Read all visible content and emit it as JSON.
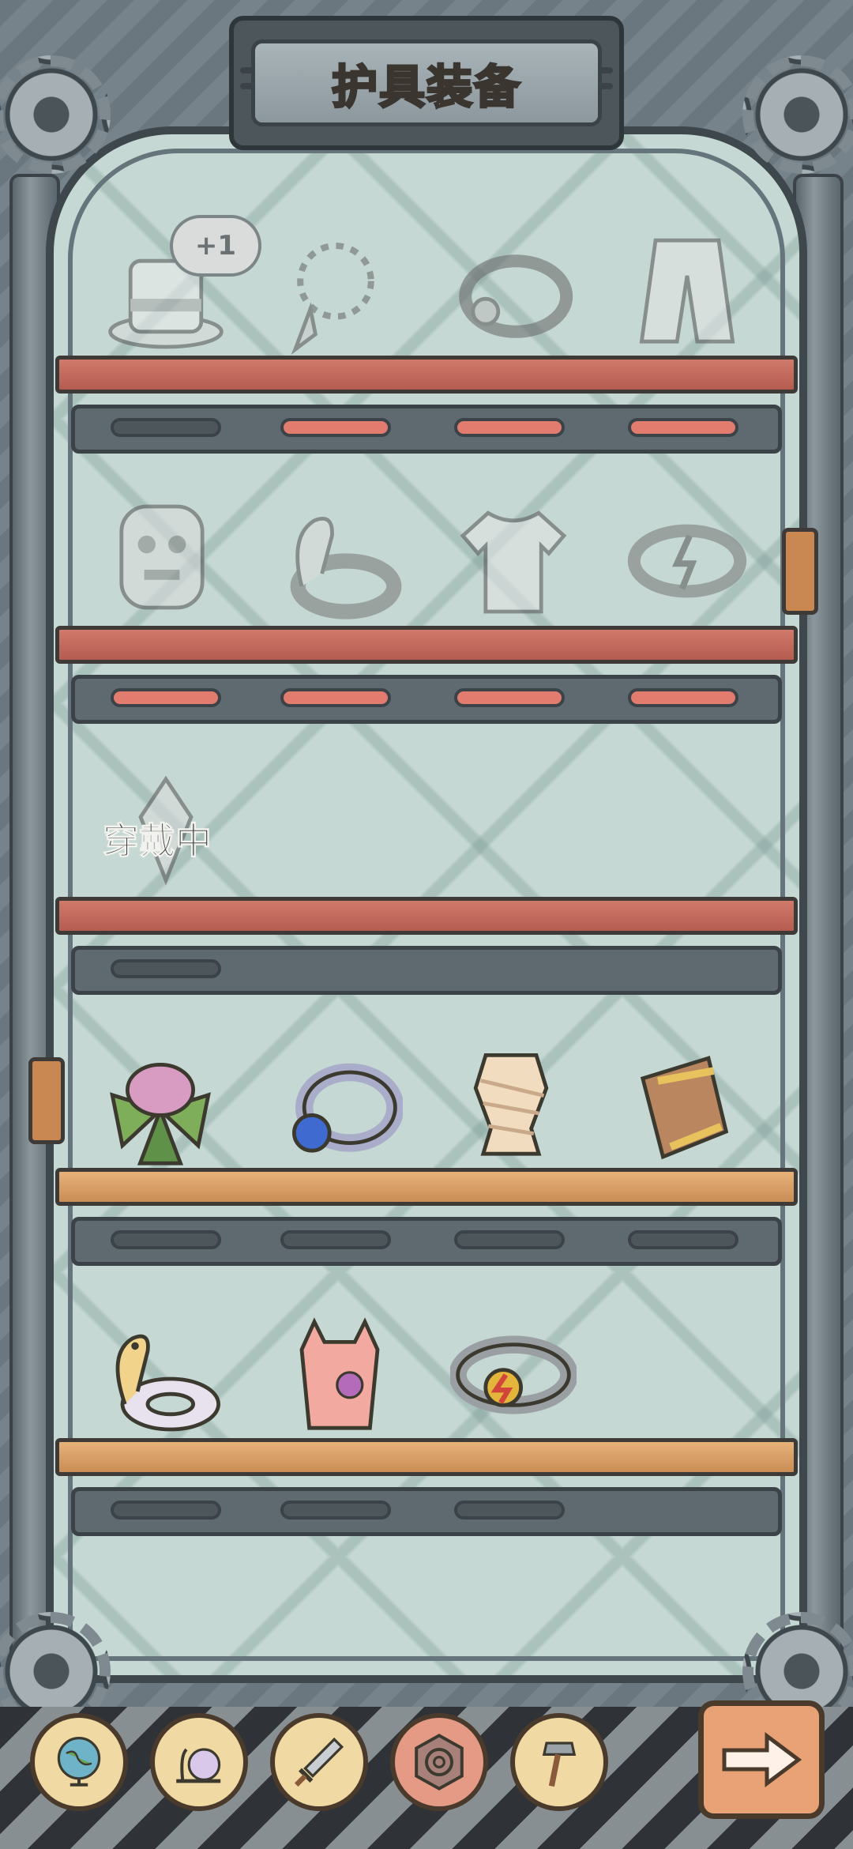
{
  "header": {
    "title": "护具装备"
  },
  "badges": {
    "hat_count": "+1"
  },
  "status": {
    "wearing_label": "穿戴中"
  },
  "shelves": [
    {
      "row": 1,
      "unlocked": false,
      "items": [
        "hat",
        "necklace",
        "ring",
        "pants"
      ]
    },
    {
      "row": 2,
      "unlocked": false,
      "items": [
        "mask",
        "swim-ring-serpent",
        "shirt",
        "bracelet"
      ]
    },
    {
      "row": 3,
      "unlocked": false,
      "items": [
        "feather-ornament"
      ]
    },
    {
      "row": 4,
      "unlocked": true,
      "items": [
        "leaf-flower",
        "sapphire-ring",
        "bandage-armor",
        "wood-plate-armor"
      ]
    },
    {
      "row": 5,
      "unlocked": true,
      "items": [
        "swan-swim-ring",
        "pink-vest",
        "lightning-wristband"
      ]
    }
  ],
  "bottom_nav": [
    {
      "name": "globe-icon",
      "active": false
    },
    {
      "name": "snail-icon",
      "active": false
    },
    {
      "name": "sword-icon",
      "active": false
    },
    {
      "name": "armor-icon",
      "active": true
    },
    {
      "name": "hammer-icon",
      "active": false
    }
  ],
  "colors": {
    "title_fill": "#f3e2b8",
    "plank_red": "#c86b5e",
    "plank_wood": "#d99d63",
    "slot_active": "#e17c6e",
    "nav_bg": "#f0d9a3",
    "nav_active": "#e59a85"
  }
}
